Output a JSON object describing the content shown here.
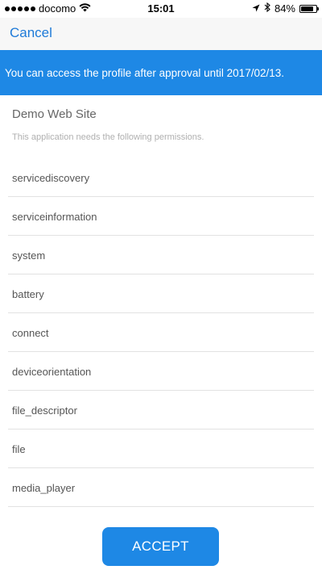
{
  "status_bar": {
    "carrier": "docomo",
    "time": "15:01",
    "battery_percent": "84%",
    "battery_level": 0.84,
    "icons": [
      "signal-dots-icon",
      "wifi-icon",
      "location-icon",
      "bluetooth-icon",
      "battery-icon"
    ]
  },
  "nav": {
    "cancel_label": "Cancel"
  },
  "banner": {
    "text": "You can access the profile after approval until 2017/02/13."
  },
  "site": {
    "name": "Demo Web Site",
    "description": "This application needs the following permissions."
  },
  "permissions": [
    "servicediscovery",
    "serviceinformation",
    "system",
    "battery",
    "connect",
    "deviceorientation",
    "file_descriptor",
    "file",
    "media_player"
  ],
  "accept_label": "ACCEPT",
  "colors": {
    "accent": "#1e88e5",
    "link": "#1e7ad8",
    "nav_bg": "#f7f7f7",
    "divider": "#e2e2e2"
  }
}
